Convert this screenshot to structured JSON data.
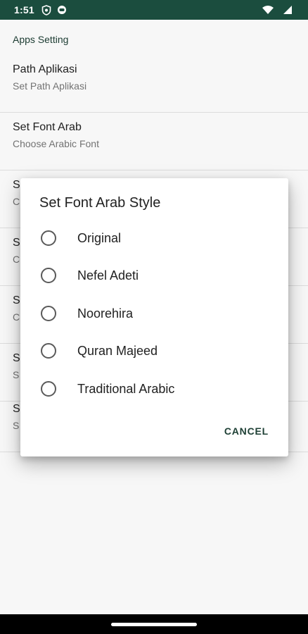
{
  "status_bar": {
    "time": "1:51",
    "icons": [
      "shield-icon",
      "face-icon"
    ],
    "right_icons": [
      "wifi-icon",
      "signal-icon"
    ],
    "color": "#1b4d3e"
  },
  "settings": {
    "section_title": "Apps Setting",
    "items": [
      {
        "title": "Path Aplikasi",
        "summary": "Set Path Aplikasi"
      },
      {
        "title": "Set Font Arab",
        "summary": "Choose Arabic Font"
      },
      {
        "title": "S",
        "summary": "C"
      },
      {
        "title": "S",
        "summary": "C"
      },
      {
        "title": "S",
        "summary": "C"
      },
      {
        "title": "S",
        "summary": "S"
      },
      {
        "title": "S",
        "summary": "S"
      }
    ]
  },
  "dialog": {
    "title": "Set Font Arab Style",
    "options": [
      {
        "label": "Original",
        "selected": false
      },
      {
        "label": "Nefel Adeti",
        "selected": false
      },
      {
        "label": "Noorehira",
        "selected": false
      },
      {
        "label": "Quran Majeed",
        "selected": false
      },
      {
        "label": "Traditional Arabic",
        "selected": false
      }
    ],
    "cancel_label": "CANCEL"
  }
}
